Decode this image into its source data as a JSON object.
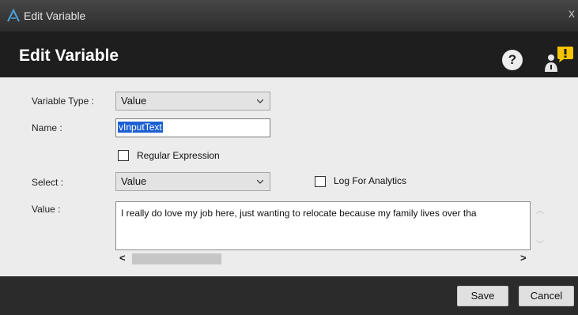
{
  "window": {
    "title": "Edit Variable",
    "close_glyph": "x"
  },
  "header": {
    "title": "Edit Variable",
    "help_glyph": "?"
  },
  "icons": {
    "app": "app-logo-icon",
    "help": "help-icon",
    "user_alert": "user-alert-icon"
  },
  "colors": {
    "header_bg": "#1e1e1e",
    "selection": "#1b5fd1",
    "alert": "#f4c400"
  },
  "form": {
    "variable_type": {
      "label": "Variable Type :",
      "value": "Value"
    },
    "name": {
      "label": "Name :",
      "value": "vInputText"
    },
    "regular_expression": {
      "label": "Regular Expression",
      "checked": false
    },
    "select": {
      "label": "Select :",
      "value": "Value"
    },
    "log_for_analytics": {
      "label": "Log For Analytics",
      "checked": false
    },
    "value": {
      "label": "Value :",
      "text": "I really do love my job here, just wanting to relocate because my family lives over tha"
    },
    "hscroll": {
      "left_glyph": "<",
      "right_glyph": ">"
    },
    "vscroll": {
      "up_glyph": "︿",
      "down_glyph": "﹀"
    }
  },
  "footer": {
    "save_label": "Save",
    "cancel_label": "Cancel"
  }
}
